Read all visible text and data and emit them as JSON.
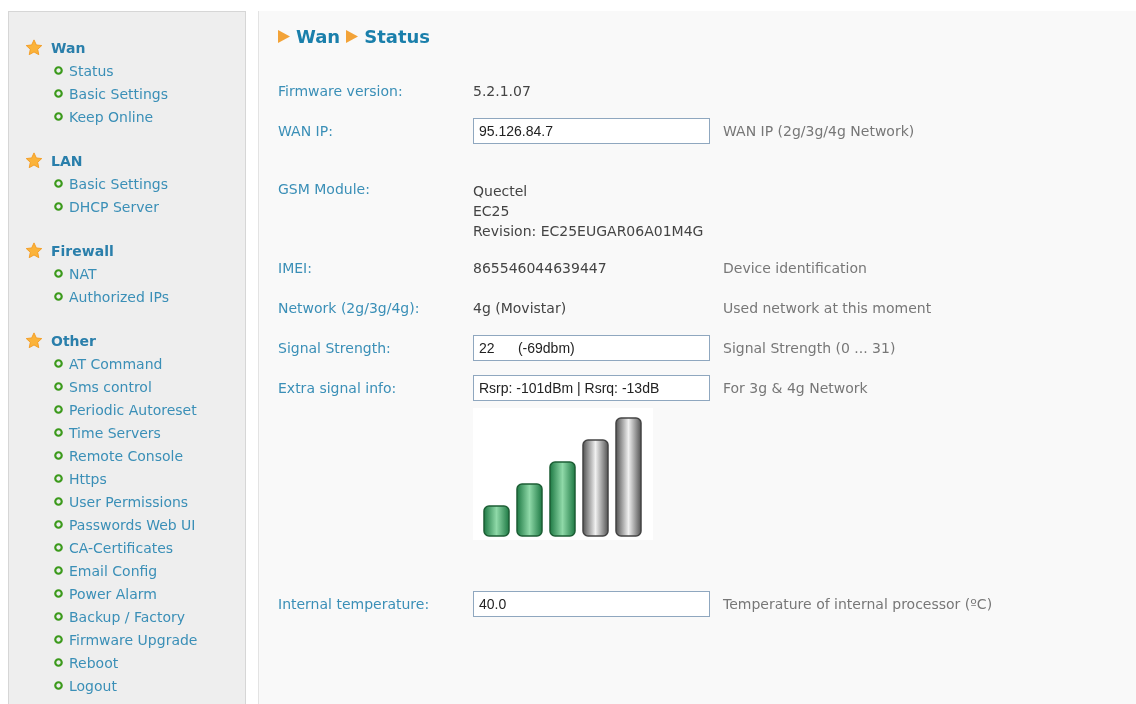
{
  "sidebar": {
    "groups": [
      {
        "title": "Wan",
        "items": [
          {
            "label": "Status"
          },
          {
            "label": "Basic Settings"
          },
          {
            "label": "Keep Online"
          }
        ]
      },
      {
        "title": "LAN",
        "items": [
          {
            "label": "Basic Settings"
          },
          {
            "label": "DHCP Server"
          }
        ]
      },
      {
        "title": "Firewall",
        "items": [
          {
            "label": "NAT"
          },
          {
            "label": "Authorized IPs"
          }
        ]
      },
      {
        "title": "Other",
        "items": [
          {
            "label": "AT Command"
          },
          {
            "label": "Sms control"
          },
          {
            "label": "Periodic Autoreset"
          },
          {
            "label": "Time Servers"
          },
          {
            "label": "Remote Console"
          },
          {
            "label": "Https"
          },
          {
            "label": "User Permissions"
          },
          {
            "label": "Passwords Web UI"
          },
          {
            "label": "CA-Certificates"
          },
          {
            "label": "Email Config"
          },
          {
            "label": "Power Alarm"
          },
          {
            "label": "Backup / Factory"
          },
          {
            "label": "Firmware Upgrade"
          },
          {
            "label": "Reboot"
          },
          {
            "label": "Logout"
          }
        ]
      }
    ]
  },
  "breadcrumb": [
    "Wan",
    "Status"
  ],
  "rows": [
    {
      "kind": "text",
      "label": "Firmware version:",
      "value": "5.2.1.07"
    },
    {
      "kind": "input",
      "label": "WAN IP:",
      "value": "95.126.84.7",
      "hint": "WAN IP (2g/3g/4g Network)"
    },
    {
      "kind": "lines",
      "label": "GSM Module:",
      "lines": [
        "Quectel",
        "EC25",
        "Revision: EC25EUGAR06A01M4G"
      ]
    },
    {
      "kind": "text",
      "label": "IMEI:",
      "value": "865546044639447",
      "hint": "Device identification"
    },
    {
      "kind": "text",
      "label": "Network (2g/3g/4g):",
      "value": "4g (Movistar)",
      "hint": "Used network at this moment"
    },
    {
      "kind": "input",
      "label": "Signal Strength:",
      "value": "22      (-69dbm)",
      "hint": "Signal Strength (0 ... 31)"
    },
    {
      "kind": "input",
      "label": "Extra signal info:",
      "value": "Rsrp: -101dBm | Rsrq: -13dB",
      "hint": "For 3g & 4g Network"
    },
    {
      "kind": "signal"
    },
    {
      "kind": "input",
      "label": "Internal temperature:",
      "value": "40.0",
      "hint": "Temperature of internal processor (ºC)"
    }
  ]
}
